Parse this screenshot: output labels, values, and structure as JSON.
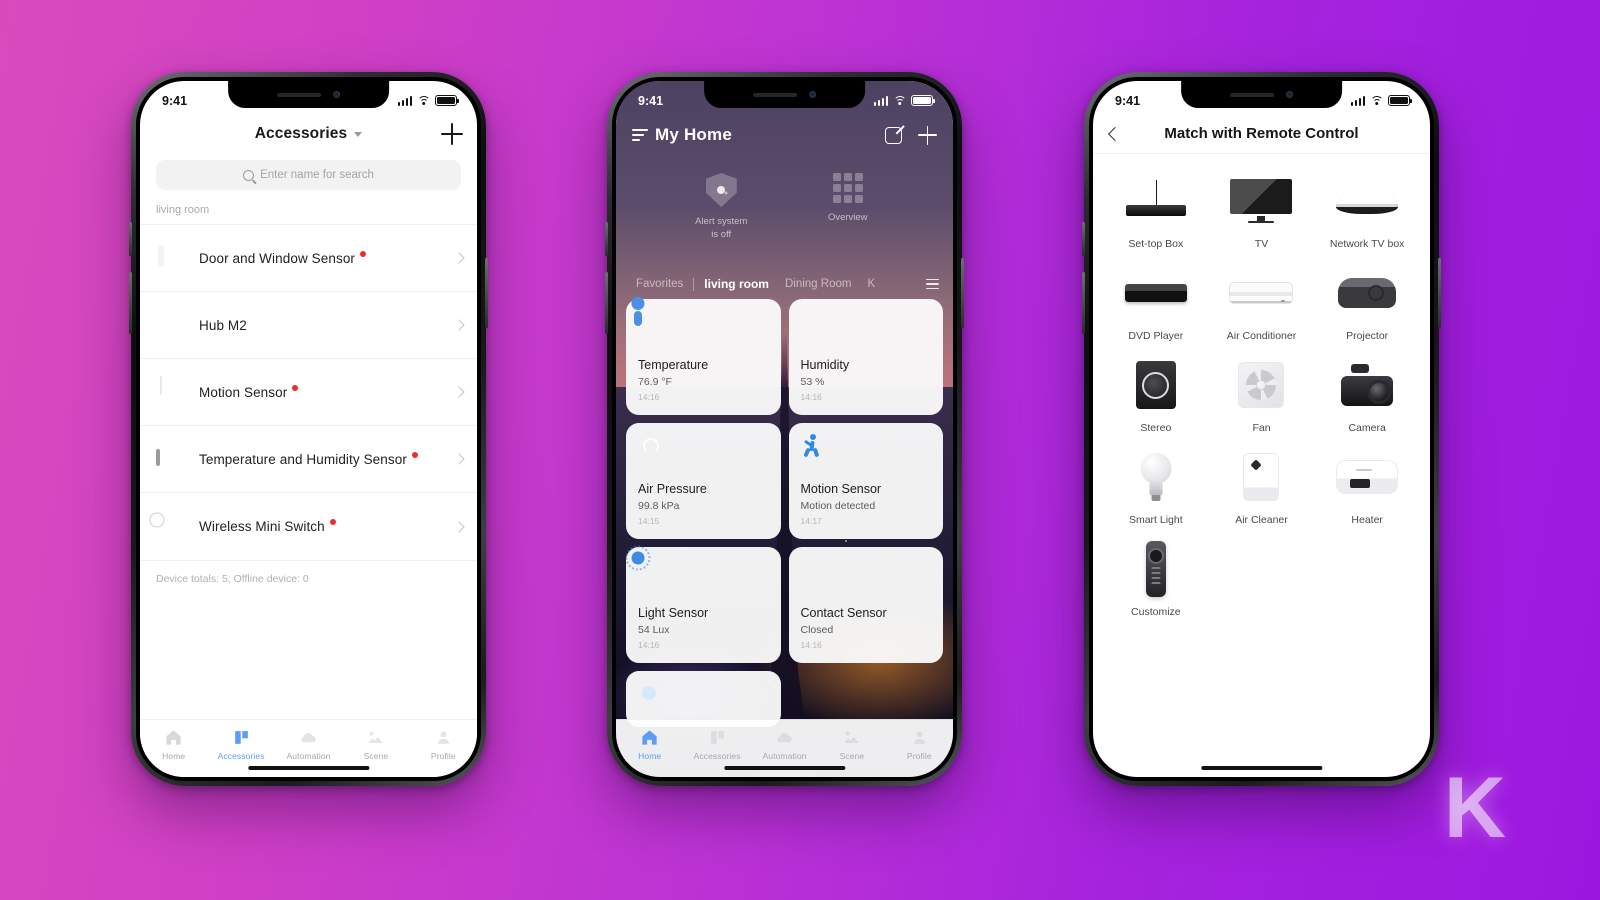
{
  "background": {
    "gradient_from": "#d94bbd",
    "gradient_to": "#9c18e0",
    "watermark": "K"
  },
  "phone1": {
    "status": {
      "time": "9:41"
    },
    "header": {
      "title": "Accessories",
      "add_label": "+"
    },
    "search": {
      "placeholder": "Enter name for search"
    },
    "section_label": "living room",
    "devices": [
      {
        "name": "Door and Window Sensor",
        "badge": true
      },
      {
        "name": "Hub M2",
        "badge": false
      },
      {
        "name": "Motion Sensor",
        "badge": true
      },
      {
        "name": "Temperature and Humidity Sensor",
        "badge": true
      },
      {
        "name": "Wireless Mini Switch",
        "badge": true
      }
    ],
    "totals": "Device totals: 5; Offline device: 0",
    "tabs": [
      {
        "label": "Home",
        "active": false
      },
      {
        "label": "Accessories",
        "active": true
      },
      {
        "label": "Automation",
        "active": false
      },
      {
        "label": "Scene",
        "active": false
      },
      {
        "label": "Profile",
        "active": false
      }
    ]
  },
  "phone2": {
    "status": {
      "time": "9:41"
    },
    "header": {
      "title": "My Home"
    },
    "shortcuts": [
      {
        "label": "Alert system\nis off",
        "icon": "shield-icon"
      },
      {
        "label": "Overview",
        "icon": "grid-icon"
      }
    ],
    "shortcut_alert_line1": "Alert system",
    "shortcut_alert_line2": "is off",
    "shortcut_overview": "Overview",
    "rooms": [
      {
        "label": "Favorites",
        "active": false
      },
      {
        "label": "living room",
        "active": true
      },
      {
        "label": "Dining Room",
        "active": false
      },
      {
        "label": "K",
        "active": false
      }
    ],
    "cards": [
      {
        "title": "Temperature",
        "value": "76.9 °F",
        "time": "14:16",
        "icon": "thermometer-icon"
      },
      {
        "title": "Humidity",
        "value": "53 %",
        "time": "14:16",
        "icon": "water-drop-icon"
      },
      {
        "title": "Air Pressure",
        "value": "99.8 kPa",
        "time": "14:15",
        "icon": "gauge-icon"
      },
      {
        "title": "Motion Sensor",
        "value": "Motion detected",
        "time": "14:17",
        "icon": "walking-person-icon"
      },
      {
        "title": "Light Sensor",
        "value": "54 Lux",
        "time": "14:16",
        "icon": "sun-icon"
      },
      {
        "title": "Contact Sensor",
        "value": "Closed",
        "time": "14:16",
        "icon": "door-contact-icon"
      }
    ],
    "tabs": [
      {
        "label": "Home",
        "active": true
      },
      {
        "label": "Accessories",
        "active": false
      },
      {
        "label": "Automation",
        "active": false
      },
      {
        "label": "Scene",
        "active": false
      },
      {
        "label": "Profile",
        "active": false
      }
    ]
  },
  "phone3": {
    "status": {
      "time": "9:41"
    },
    "header": {
      "title": "Match with Remote Control"
    },
    "devices": [
      {
        "label": "Set-top Box",
        "icon": "set-top-box-icon"
      },
      {
        "label": "TV",
        "icon": "tv-icon"
      },
      {
        "label": "Network TV box",
        "icon": "network-tv-box-icon"
      },
      {
        "label": "DVD Player",
        "icon": "dvd-player-icon"
      },
      {
        "label": "Air Conditioner",
        "icon": "air-conditioner-icon"
      },
      {
        "label": "Projector",
        "icon": "projector-icon"
      },
      {
        "label": "Stereo",
        "icon": "stereo-icon"
      },
      {
        "label": "Fan",
        "icon": "fan-icon"
      },
      {
        "label": "Camera",
        "icon": "camera-icon"
      },
      {
        "label": "Smart Light",
        "icon": "smart-light-icon"
      },
      {
        "label": "Air Cleaner",
        "icon": "air-cleaner-icon"
      },
      {
        "label": "Heater",
        "icon": "heater-icon"
      },
      {
        "label": "Customize",
        "icon": "remote-control-icon"
      }
    ]
  }
}
